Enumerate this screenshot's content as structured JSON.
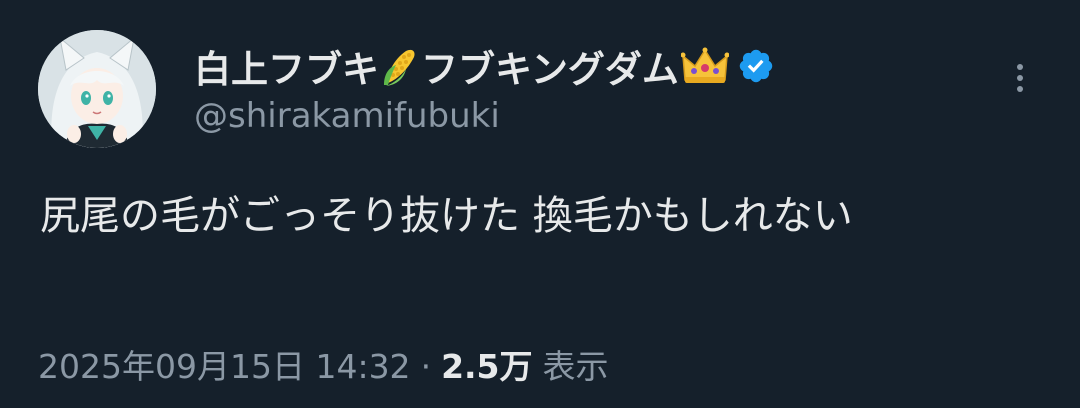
{
  "author": {
    "display_name": "白上フブキ",
    "display_name_suffix": "フブキングダム",
    "handle": "@shirakamifubuki",
    "verified": true,
    "avatar_icon": "avatar-white-haired-fox-girl"
  },
  "tweet": {
    "text": "尻尾の毛がごっそり抜けた 換毛かもしれない"
  },
  "meta": {
    "timestamp": "2025年09月15日 14:32",
    "separator": "·",
    "views_count": "2.5万",
    "views_label": "表示"
  },
  "icons": {
    "name_emoji_1": "corn-emoji",
    "name_emoji_2": "crown-emoji",
    "verified": "verified-badge-icon",
    "more": "more-options-icon"
  },
  "colors": {
    "background": "#15202b",
    "primary_text": "#e7e9ea",
    "secondary_text": "#8b98a5",
    "verified_blue": "#1d9bf0"
  }
}
